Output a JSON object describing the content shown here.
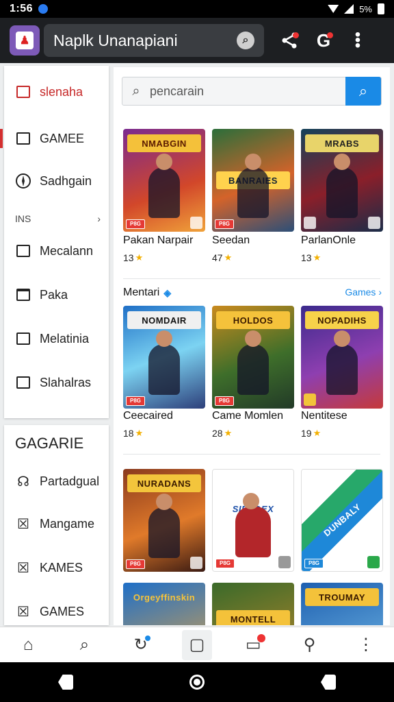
{
  "status": {
    "time": "1:56",
    "battery": "5%"
  },
  "appbar": {
    "title": "Naplk Unanapiani"
  },
  "sidebar": {
    "active_item": "slenaha",
    "items": [
      {
        "label": "GAMEE",
        "icon": "mail-icon"
      },
      {
        "label": "Sadhgain",
        "icon": "compass-icon"
      },
      {
        "label": "Mecalann",
        "icon": "tablet-icon"
      },
      {
        "label": "Paka",
        "icon": "window-icon"
      },
      {
        "label": "Melatinia",
        "icon": "square-icon"
      },
      {
        "label": "Slahalras",
        "icon": "square-icon"
      }
    ],
    "section_label": "INS",
    "section_chevron": "›",
    "group_title": "GAGARIE",
    "group_items": [
      {
        "label": "Partadgual",
        "icon": "hands-icon"
      },
      {
        "label": "Mangame",
        "icon": "x-box-icon"
      },
      {
        "label": "KAMES",
        "icon": "x-box-icon"
      },
      {
        "label": "GAMES",
        "icon": "x-box-icon"
      }
    ]
  },
  "search": {
    "placeholder": "pencarain"
  },
  "cards_logos": [
    "NMABGIN",
    "BANRAIES",
    "MRABS",
    "NOMDAIR",
    "HOLDOS",
    "NOPADIHS",
    "NURADANS",
    "SIENDEX",
    "DUNBALY",
    "Orgeyffinskin",
    "MONTELL",
    "TROUMAY"
  ],
  "games_row1": [
    {
      "title": "Pakan Narpair",
      "rating": "13"
    },
    {
      "title": "Seedan",
      "rating": "47"
    },
    {
      "title": "ParlanOnle",
      "rating": "13"
    }
  ],
  "section": {
    "title": "Mentari",
    "link": "Games ›"
  },
  "games_row2": [
    {
      "title": "Ceecaired",
      "rating": "18"
    },
    {
      "title": "Came Momlen",
      "rating": "28"
    },
    {
      "title": "Nentitese",
      "rating": "19"
    }
  ],
  "badge_text": "P8G",
  "colors": {
    "accent": "#1a8ae6",
    "active": "#c62828",
    "appbar": "#1d1f22"
  }
}
